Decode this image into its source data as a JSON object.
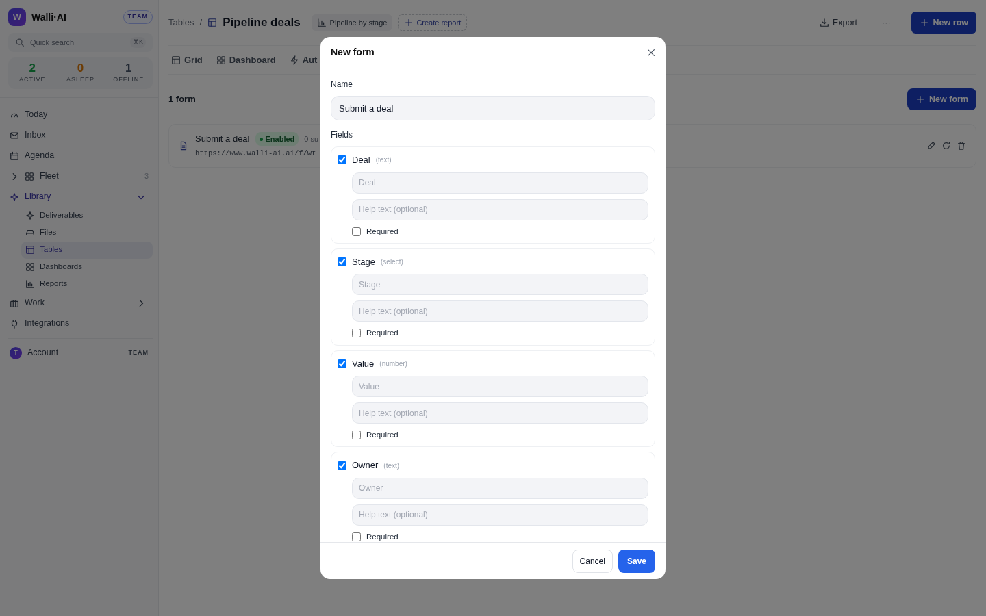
{
  "sidebar": {
    "brand": {
      "logo_letter": "W",
      "name": "Walli·AI",
      "badge": "TEAM"
    },
    "search": {
      "placeholder": "Quick search",
      "shortcut": "⌘K"
    },
    "stats": [
      {
        "value": "2",
        "label": "ACTIVE",
        "color": "#0b5125"
      },
      {
        "value": "0",
        "label": "ASLEEP",
        "color": "#6c3b03"
      },
      {
        "value": "1",
        "label": "OFFLINE",
        "color": "#232a34"
      }
    ],
    "items": [
      {
        "label": "Today",
        "selected": false
      },
      {
        "label": "Inbox",
        "selected": false
      },
      {
        "label": "Agenda",
        "selected": false
      },
      {
        "label": "Fleet",
        "count": "3",
        "expanded": false,
        "selected": false
      },
      {
        "label": "Library",
        "expanded": true,
        "selected": true,
        "children": [
          {
            "label": "Deliverables",
            "selected": false
          },
          {
            "label": "Files",
            "selected": false
          },
          {
            "label": "Tables",
            "selected": true
          },
          {
            "label": "Dashboards",
            "selected": false
          },
          {
            "label": "Reports",
            "selected": false
          }
        ]
      },
      {
        "label": "Work",
        "expanded": false,
        "selected": false
      },
      {
        "label": "Integrations",
        "selected": false
      }
    ],
    "account": {
      "initial": "T",
      "label": "Account",
      "badge": "TEAM"
    }
  },
  "header": {
    "breadcrumb": "Tables",
    "separator": "/",
    "title": "Pipeline deals",
    "report_chip": "Pipeline by stage",
    "create_report": "Create report",
    "export": "Export",
    "more": "···",
    "new_row": "New row"
  },
  "tabs": [
    {
      "label": "Grid"
    },
    {
      "label": "Dashboard"
    },
    {
      "label": "Aut"
    }
  ],
  "forms": {
    "count": "1 form",
    "new_button": "New form",
    "rows": [
      {
        "name": "Submit a deal",
        "status": "Enabled",
        "submissions": "0 su",
        "url": "https://www.walli-ai.ai/f/wt"
      }
    ]
  },
  "modal": {
    "title": "New form",
    "name_label": "Name",
    "name_value": "Submit a deal",
    "fields_label": "Fields",
    "fields": [
      {
        "label": "Deal",
        "type": "(text)",
        "checked": true,
        "placeholder": "Deal",
        "help_placeholder": "Help text (optional)",
        "required_label": "Required",
        "required": false
      },
      {
        "label": "Stage",
        "type": "(select)",
        "checked": true,
        "placeholder": "Stage",
        "help_placeholder": "Help text (optional)",
        "required_label": "Required",
        "required": false
      },
      {
        "label": "Value",
        "type": "(number)",
        "checked": true,
        "placeholder": "Value",
        "help_placeholder": "Help text (optional)",
        "required_label": "Required",
        "required": false
      },
      {
        "label": "Owner",
        "type": "(text)",
        "checked": true,
        "placeholder": "Owner",
        "help_placeholder": "Help text (optional)",
        "required_label": "Required",
        "required": false
      }
    ],
    "cancel": "Cancel",
    "save": "Save"
  }
}
